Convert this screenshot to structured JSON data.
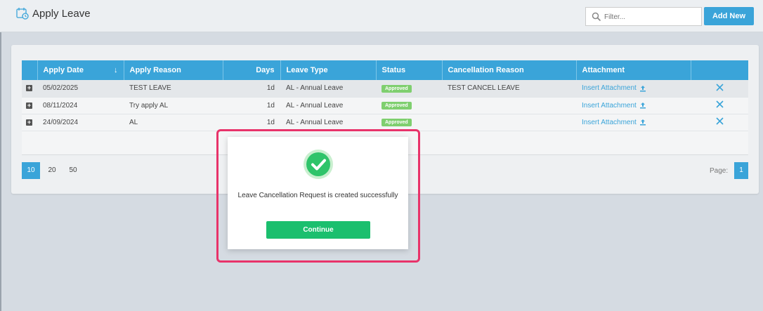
{
  "header": {
    "title": "Apply Leave",
    "filter_placeholder": "Filter...",
    "add_new_label": "Add New",
    "icon": "calendar-clock-icon"
  },
  "table": {
    "columns": [
      "Apply Date",
      "Apply Reason",
      "Days",
      "Leave Type",
      "Status",
      "Cancellation Reason",
      "Attachment",
      ""
    ],
    "sort_indicator": "↓",
    "rows": [
      {
        "date": "05/02/2025",
        "reason": "TEST LEAVE",
        "days": "1d",
        "type": "AL - Annual Leave",
        "status": "Approved",
        "cancel_reason": "TEST CANCEL LEAVE",
        "attachment": "Insert Attachment"
      },
      {
        "date": "08/11/2024",
        "reason": "Try apply AL",
        "days": "1d",
        "type": "AL - Annual Leave",
        "status": "Approved",
        "cancel_reason": "",
        "attachment": "Insert Attachment"
      },
      {
        "date": "24/09/2024",
        "reason": "AL",
        "days": "1d",
        "type": "AL - Annual Leave",
        "status": "Approved",
        "cancel_reason": "",
        "attachment": "Insert Attachment"
      }
    ]
  },
  "pagination": {
    "sizes": [
      "10",
      "20",
      "50"
    ],
    "selected_size": "10",
    "page_label": "Page:",
    "current_page": "1"
  },
  "modal": {
    "message": "Leave Cancellation Request is created successfully",
    "continue_label": "Continue"
  },
  "colors": {
    "accent": "#3aa4d9",
    "success": "#1bbf6e",
    "badge": "#7fcf6f",
    "highlight": "#e8336a"
  }
}
